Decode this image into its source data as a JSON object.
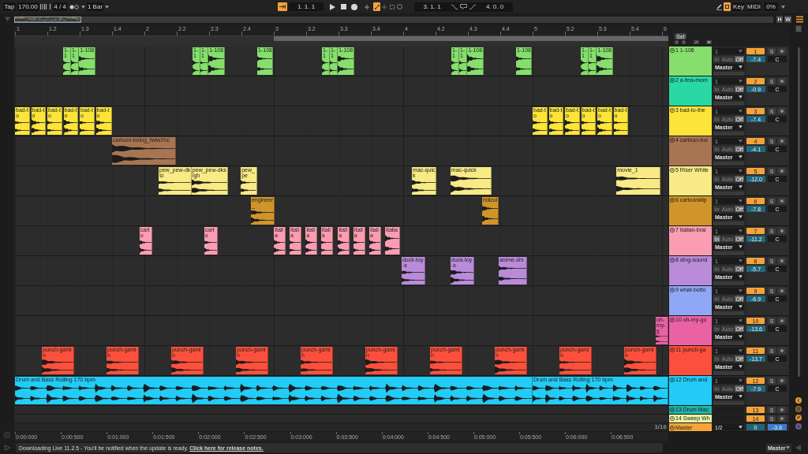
{
  "transport": {
    "tap_button": "Tap",
    "tempo": "170.00",
    "time_signature": "4 / 4",
    "quantization": "1 Bar",
    "follow_on": true,
    "song_position": "1. 1. 1",
    "automation_arm_on": true,
    "loop_start": "3. 1. 1",
    "loop_length": "4. 0. 0",
    "key_map_on": true,
    "key_button": "Key",
    "midi_button": "MIDI",
    "cpu_load": "0%"
  },
  "overview": {
    "buttons": [
      "H",
      "W"
    ]
  },
  "ruler": {
    "labels": [
      "1",
      "1.2",
      "1.3",
      "1.4",
      "2",
      "2.2",
      "2.3",
      "2.4",
      "3",
      "3.2",
      "3.3",
      "3.4",
      "4",
      "4.2",
      "4.3",
      "4.4",
      "5",
      "5.2",
      "5.3",
      "5.4",
      "6"
    ]
  },
  "set_button": "Set",
  "tracks": [
    {
      "kind": "full",
      "name": "1 1-108",
      "color": "#86df6c",
      "number": "1",
      "active": true,
      "solo": "S",
      "input": "1",
      "monitor": [
        {
          "label": "In",
          "selected": false
        },
        {
          "label": "Auto",
          "selected": false
        },
        {
          "label": "Off",
          "selected": true
        }
      ],
      "output": "Master",
      "volume": "-7.4",
      "pan": "C",
      "clips": [
        {
          "name": "1-1"
        },
        {
          "name": "1-1"
        },
        {
          "name": "1-108"
        },
        {
          "name": "1-1"
        },
        {
          "name": "1-1"
        },
        {
          "name": "1-108"
        },
        {
          "name": "1-108"
        },
        {
          "name": "1-1"
        },
        {
          "name": "1-1"
        },
        {
          "name": "1-108"
        },
        {
          "name": "1-1"
        },
        {
          "name": "1-1"
        },
        {
          "name": "1-108"
        },
        {
          "name": "1-108"
        },
        {
          "name": "1-1"
        },
        {
          "name": "1-1"
        },
        {
          "name": "1-108"
        }
      ]
    },
    {
      "kind": "full",
      "name": "2 a-few-mom",
      "color": "#2ad8a4",
      "number": "2",
      "active": true,
      "solo": "S",
      "input": "1",
      "monitor": [
        {
          "label": "In",
          "selected": false
        },
        {
          "label": "Auto",
          "selected": false
        },
        {
          "label": "Off",
          "selected": true
        }
      ],
      "output": "Master",
      "volume": "-0.9",
      "pan": "C"
    },
    {
      "kind": "full",
      "name": "3 bad-to-the",
      "color": "#fde43a",
      "number": "3",
      "active": true,
      "solo": "S",
      "input": "1",
      "monitor": [
        {
          "label": "In",
          "selected": false
        },
        {
          "label": "Auto",
          "selected": false
        },
        {
          "label": "Off",
          "selected": true
        }
      ],
      "output": "Master",
      "volume": "-7.4",
      "pan": "C",
      "clips": [
        {
          "name": "bad-to"
        },
        {
          "name": "bad-to"
        },
        {
          "name": "bad-to"
        },
        {
          "name": "bad-to"
        },
        {
          "name": "bad-to"
        },
        {
          "name": "bad-to"
        },
        {
          "name": "bad-to"
        },
        {
          "name": "bad-to"
        },
        {
          "name": "bad-to"
        },
        {
          "name": "bad-to"
        },
        {
          "name": "bad-to"
        },
        {
          "name": "bad-to"
        }
      ]
    },
    {
      "kind": "full",
      "name": "4 cartoon-boi",
      "color": "#a87552",
      "number": "4",
      "active": true,
      "solo": "S",
      "input": "1",
      "monitor": [
        {
          "label": "In",
          "selected": false
        },
        {
          "label": "Auto",
          "selected": false
        },
        {
          "label": "Off",
          "selected": true
        }
      ],
      "output": "Master",
      "volume": "-4.1",
      "pan": "C",
      "clips": [
        {
          "name": "cartoon-boing_fwlwXhc"
        }
      ]
    },
    {
      "kind": "full",
      "name": "5 Riser White",
      "color": "#f8ea84",
      "number": "5",
      "active": true,
      "solo": "S",
      "input": "1",
      "monitor": [
        {
          "label": "In",
          "selected": false
        },
        {
          "label": "Auto",
          "selected": false
        },
        {
          "label": "Off",
          "selected": true
        }
      ],
      "output": "Master",
      "volume": "-12.0",
      "pan": "C",
      "clips": [
        {
          "name": "pew_pew-dksi"
        },
        {
          "name": "pew_pew-dksigh"
        },
        {
          "name": "pew_pe"
        },
        {
          "name": "mac-quick"
        },
        {
          "name": "mac-quick"
        },
        {
          "name": "movie_1"
        }
      ]
    },
    {
      "kind": "full",
      "name": "6 cartoonklip",
      "color": "#d0952a",
      "number": "6",
      "active": true,
      "solo": "S",
      "input": "1",
      "monitor": [
        {
          "label": "In",
          "selected": false
        },
        {
          "label": "Auto",
          "selected": false
        },
        {
          "label": "Off",
          "selected": true
        }
      ],
      "output": "Master",
      "volume": "-7.8",
      "pan": "C",
      "clips": [
        {
          "name": "engineer_"
        },
        {
          "name": "ridicul"
        }
      ]
    },
    {
      "kind": "full",
      "name": "7 Italian-brai",
      "color": "#fb9db2",
      "number": "7",
      "active": true,
      "solo": "S",
      "input": "1",
      "monitor": [
        {
          "label": "In",
          "selected": true
        },
        {
          "label": "Auto",
          "selected": false
        },
        {
          "label": "Off",
          "selected": true
        }
      ],
      "output": "Master",
      "volume": "-11.2",
      "pan": "C",
      "clips": [
        {
          "name": "carto"
        },
        {
          "name": "carto"
        },
        {
          "name": "Italia"
        },
        {
          "name": "Italia"
        },
        {
          "name": "Italia"
        },
        {
          "name": "Italia"
        },
        {
          "name": "Italia"
        },
        {
          "name": "Italia"
        },
        {
          "name": "Italia"
        },
        {
          "name": "Italia"
        }
      ]
    },
    {
      "kind": "full",
      "name": "8 ding-sound",
      "color": "#b98bd9",
      "number": "8",
      "active": true,
      "solo": "S",
      "input": "1",
      "monitor": [
        {
          "label": "In",
          "selected": false
        },
        {
          "label": "Auto",
          "selected": false
        },
        {
          "label": "Off",
          "selected": true
        }
      ],
      "output": "Master",
      "volume": "-5.7",
      "pan": "C",
      "clips": [
        {
          "name": "duck-toy-s"
        },
        {
          "name": "duck-toy-s"
        },
        {
          "name": "anime-shi"
        }
      ]
    },
    {
      "kind": "full",
      "name": "9 what-botto",
      "color": "#8fa7f6",
      "number": "9",
      "active": true,
      "solo": "S",
      "input": "1",
      "monitor": [
        {
          "label": "In",
          "selected": false
        },
        {
          "label": "Auto",
          "selected": false
        },
        {
          "label": "Off",
          "selected": true
        }
      ],
      "output": "Master",
      "volume": "-6.9",
      "pan": "C"
    },
    {
      "kind": "full",
      "name": "10 oh-my-go",
      "color": "#ea62a3",
      "number": "10",
      "active": true,
      "solo": "S",
      "input": "1",
      "monitor": [
        {
          "label": "In",
          "selected": false
        },
        {
          "label": "Auto",
          "selected": false
        },
        {
          "label": "Off",
          "selected": true
        }
      ],
      "output": "Master",
      "volume": "-13.6",
      "pan": "C",
      "clips": [
        {
          "name": "oh-my-g"
        }
      ]
    },
    {
      "kind": "full",
      "name": "11 punch-ga",
      "color": "#fc503c",
      "number": "11",
      "active": true,
      "solo": "S",
      "input": "1",
      "monitor": [
        {
          "label": "In",
          "selected": false
        },
        {
          "label": "Auto",
          "selected": false
        },
        {
          "label": "Off",
          "selected": true
        }
      ],
      "output": "Master",
      "volume": "-13.7",
      "pan": "C",
      "clips": [
        {
          "name": "punch-gamin"
        },
        {
          "name": "punch-gamin"
        },
        {
          "name": "punch-gamin"
        },
        {
          "name": "punch-gamin"
        },
        {
          "name": "punch-gamin"
        },
        {
          "name": "punch-gamin"
        },
        {
          "name": "punch-gamin"
        },
        {
          "name": "punch-gamin"
        },
        {
          "name": "punch-gamin"
        },
        {
          "name": "punch-gamin"
        }
      ]
    },
    {
      "kind": "full",
      "name": "12 Drum and",
      "color": "#22ccf6",
      "number": "12",
      "active": true,
      "solo": "S",
      "input": "1",
      "monitor": [
        {
          "label": "In",
          "selected": false
        },
        {
          "label": "Auto",
          "selected": false
        },
        {
          "label": "Off",
          "selected": true
        }
      ],
      "output": "Master",
      "volume": "-7.9",
      "pan": "C",
      "clips": [
        {
          "name": "Drum and Bass Rolling 170 bpm"
        },
        {
          "name": "Drum and Bass Rolling 170 bpm"
        }
      ]
    },
    {
      "kind": "compact",
      "name": "13 Drum Mac",
      "color": "#1fb6ad",
      "number": "13",
      "active": true,
      "solo": "S"
    },
    {
      "kind": "compact",
      "name": "14 Sweep Wh",
      "color": "#e8f4a4",
      "number": "14",
      "active": true,
      "solo": "S"
    }
  ],
  "master": {
    "name": "Master",
    "color": "#f4a53a",
    "output": "1/2",
    "cue_volume": "0",
    "volume": "-3.6"
  },
  "grid_setting": "1/16",
  "time_ruler": {
    "labels": [
      "0:00:000",
      "0:00:500",
      "0:01:000",
      "0:01:500",
      "0:02:000",
      "0:02:500",
      "0:03:000",
      "0:03:500",
      "0:04:000",
      "0:04:500",
      "0:05:000",
      "0:05:500",
      "0:06:000",
      "0:06:500"
    ]
  },
  "status_bar": {
    "message": "Downloading Live 11.2.5 - You'll be notified when the update is ready.",
    "link": "Click here for release notes.",
    "output": "Master"
  }
}
